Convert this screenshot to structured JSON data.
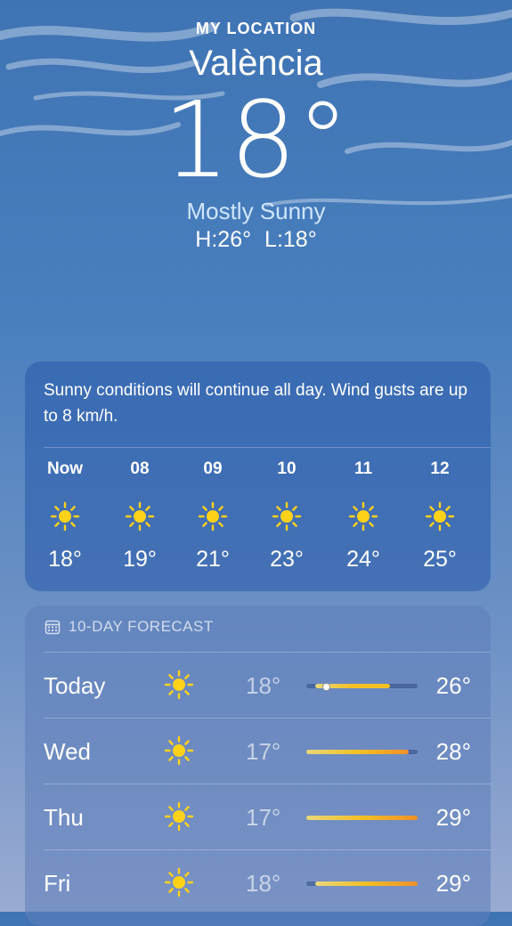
{
  "location": {
    "label": "MY LOCATION",
    "city": "València",
    "temp": "18°",
    "condition": "Mostly Sunny",
    "high_low": "H:26° L:18°"
  },
  "hourly": {
    "summary": "Sunny conditions will continue all day. Wind gusts are up to 8 km/h.",
    "items": [
      {
        "time": "Now",
        "icon": "sun-icon",
        "temp": "18°"
      },
      {
        "time": "08",
        "icon": "sun-icon",
        "temp": "19°"
      },
      {
        "time": "09",
        "icon": "sun-icon",
        "temp": "21°"
      },
      {
        "time": "10",
        "icon": "sun-icon",
        "temp": "23°"
      },
      {
        "time": "11",
        "icon": "sun-icon",
        "temp": "24°"
      },
      {
        "time": "12",
        "icon": "sun-icon",
        "temp": "25°"
      }
    ]
  },
  "forecast": {
    "title": "10-DAY FORECAST",
    "icon": "calendar-icon",
    "range_low": 17,
    "range_high": 29,
    "days": [
      {
        "day": "Today",
        "icon": "sun-icon",
        "low": "18°",
        "high": "26°",
        "low_value": 18,
        "high_value": 26,
        "current_value": 18
      },
      {
        "day": "Wed",
        "icon": "sun-icon",
        "low": "17°",
        "high": "28°",
        "low_value": 17,
        "high_value": 28
      },
      {
        "day": "Thu",
        "icon": "sun-icon",
        "low": "17°",
        "high": "29°",
        "low_value": 17,
        "high_value": 29
      },
      {
        "day": "Fri",
        "icon": "sun-icon",
        "low": "18°",
        "high": "29°",
        "low_value": 18,
        "high_value": 29
      }
    ]
  },
  "colors": {
    "sun": "#ffd21a",
    "bar_start": "#e8d77a",
    "bar_mid": "#f2c024",
    "bar_end": "#f0902a",
    "condition": "#cfe6ff"
  }
}
